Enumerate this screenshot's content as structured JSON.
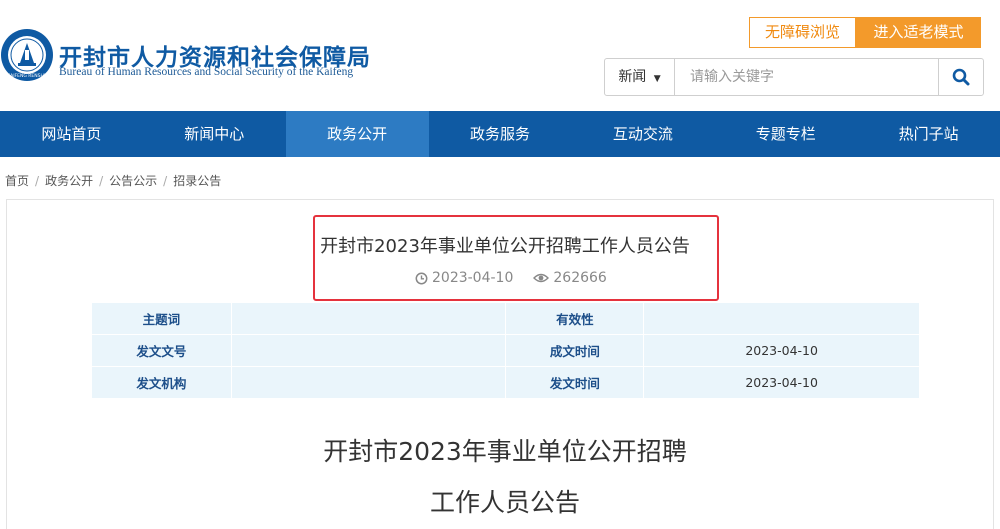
{
  "header": {
    "title": "开封市人力资源和社会保障局",
    "subtitle": "Bureau of Human Resources and Social Security of the Kaifeng",
    "logo_text": "KAIFENG RENSHE",
    "accessibility_label": "无障碍浏览",
    "elder_mode_label": "进入适老模式"
  },
  "search": {
    "category": "新闻",
    "placeholder": "请输入关键字"
  },
  "nav": {
    "items": [
      "网站首页",
      "新闻中心",
      "政务公开",
      "政务服务",
      "互动交流",
      "专题专栏",
      "热门子站"
    ],
    "active_index": 2
  },
  "breadcrumb": [
    "首页",
    "政务公开",
    "公告公示",
    "招录公告"
  ],
  "article": {
    "title": "开封市2023年事业单位公开招聘工作人员公告",
    "date": "2023-04-10",
    "views": "262666",
    "body_title_line1": "开封市2023年事业单位公开招聘",
    "body_title_line2": "工作人员公告"
  },
  "info_table": {
    "rows": [
      {
        "l1": "主题词",
        "v1": "",
        "l2": "有效性",
        "v2": ""
      },
      {
        "l1": "发文文号",
        "v1": "",
        "l2": "成文时间",
        "v2": "2023-04-10"
      },
      {
        "l1": "发文机构",
        "v1": "",
        "l2": "发文时间",
        "v2": "2023-04-10"
      }
    ]
  },
  "colors": {
    "brand_blue": "#0f5aa3",
    "nav_active": "#2d7bc3",
    "accent_orange": "#f39a2b",
    "highlight_red": "#e5323d",
    "table_bg": "#eaf5fb"
  }
}
